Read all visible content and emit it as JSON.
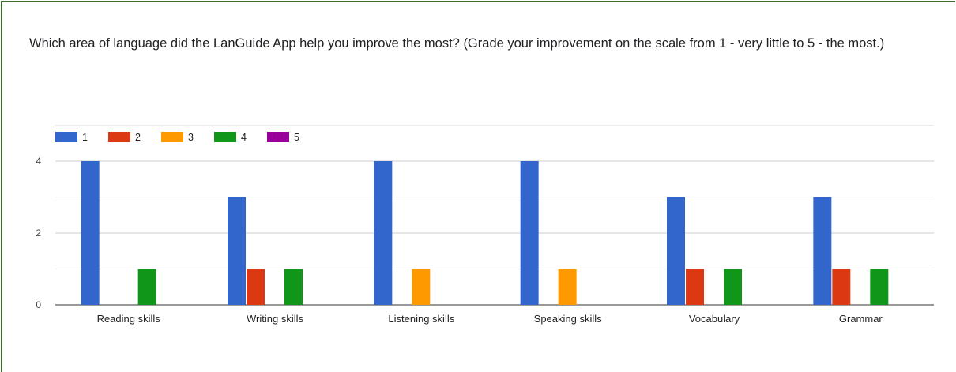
{
  "question": "Which area of language did the LanGuide App help you improve the most? (Grade your improvement on the scale from 1 - very little to 5 - the most.)",
  "chart_data": {
    "type": "bar",
    "categories": [
      "Reading skills",
      "Writing skills",
      "Listening skills",
      "Speaking skills",
      "Vocabulary",
      "Grammar"
    ],
    "series": [
      {
        "name": "1",
        "color": "#3366cc",
        "values": [
          4,
          3,
          4,
          4,
          3,
          3
        ]
      },
      {
        "name": "2",
        "color": "#dc3912",
        "values": [
          0,
          1,
          0,
          0,
          1,
          1
        ]
      },
      {
        "name": "3",
        "color": "#ff9900",
        "values": [
          0,
          0,
          1,
          1,
          0,
          0
        ]
      },
      {
        "name": "4",
        "color": "#109618",
        "values": [
          1,
          1,
          0,
          0,
          1,
          1
        ]
      },
      {
        "name": "5",
        "color": "#990099",
        "values": [
          0,
          0,
          0,
          0,
          0,
          0
        ]
      }
    ],
    "yticks": [
      0,
      2,
      4
    ],
    "ylim": [
      0,
      5
    ],
    "legend": "top-left",
    "grid": true
  }
}
